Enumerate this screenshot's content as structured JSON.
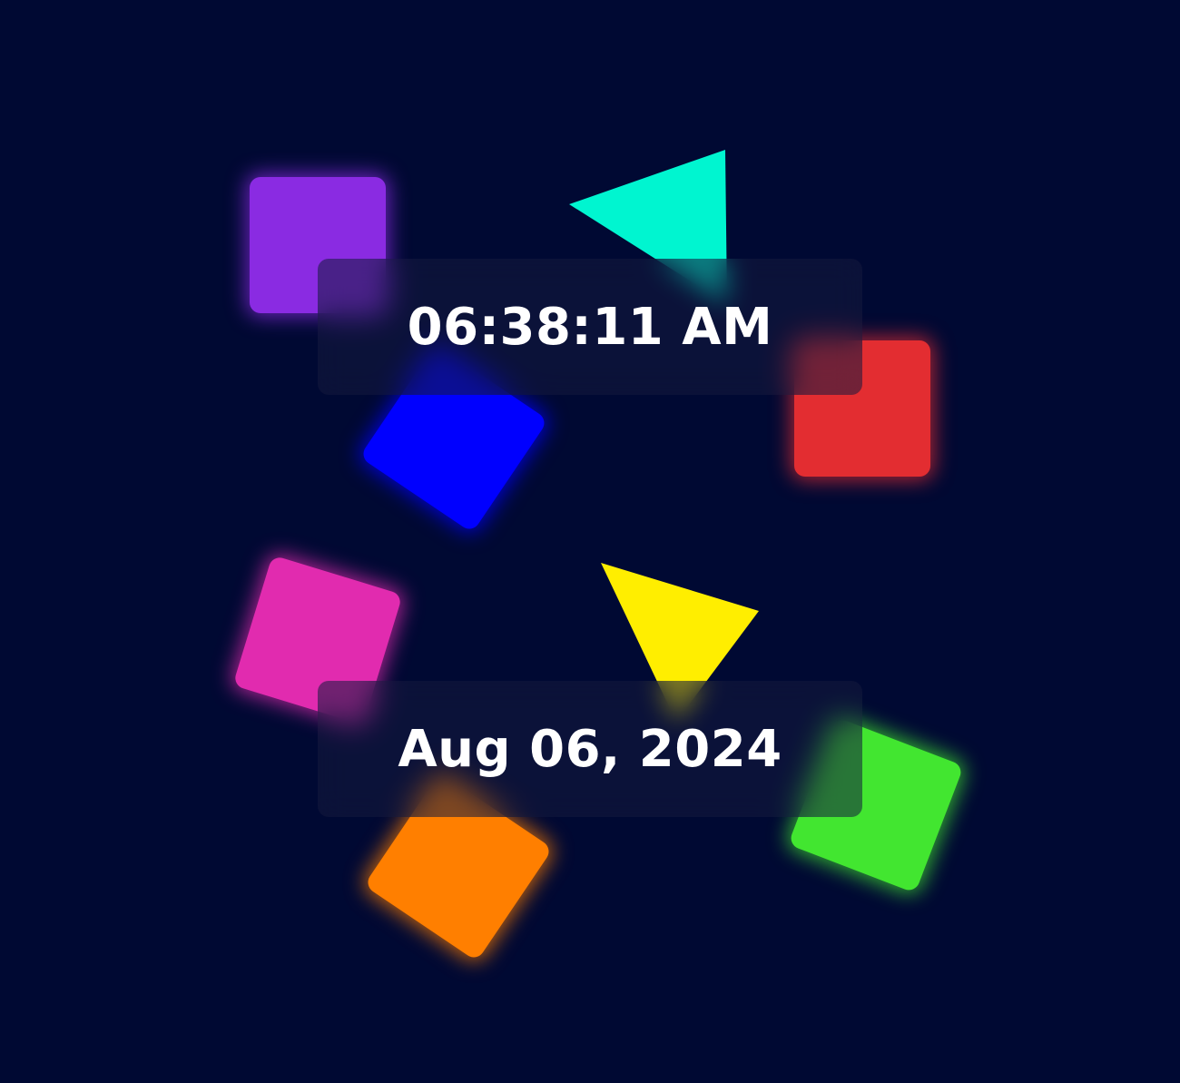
{
  "clock": {
    "time": "06:38:11 AM",
    "date": "Aug 06, 2024"
  },
  "colors": {
    "background": "#000933",
    "purple": "#8a2be2",
    "red": "#e32d31",
    "blue": "#0000ff",
    "pink": "#e12baf",
    "green": "#42e630",
    "orange": "#ff7f00",
    "teal": "#00f5d0",
    "yellow": "#ffee00",
    "text": "#ffffff"
  }
}
